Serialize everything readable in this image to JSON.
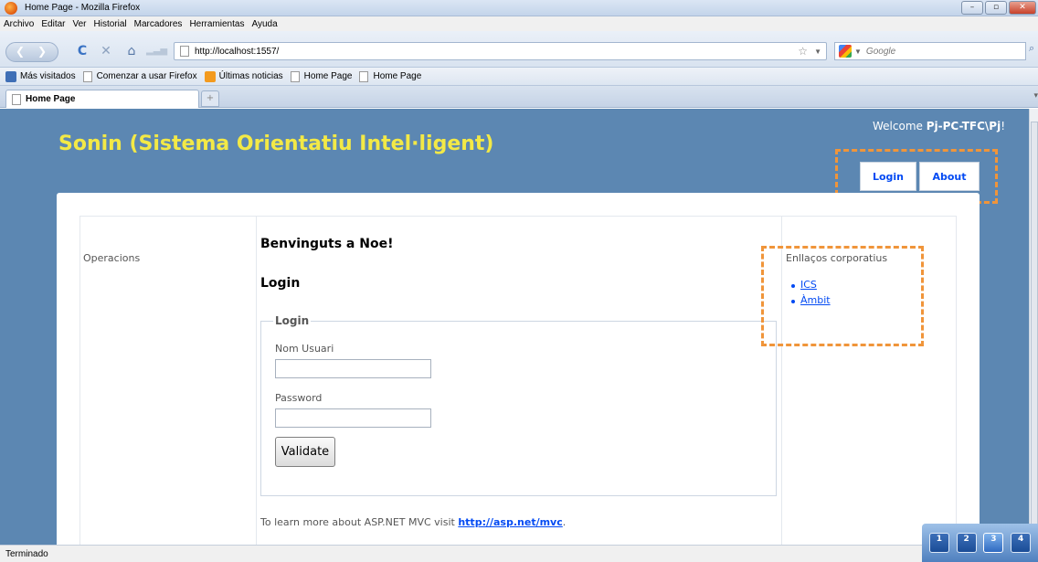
{
  "window": {
    "title": "Home Page - Mozilla Firefox",
    "controls": [
      "–",
      "▫",
      "✕"
    ]
  },
  "menubar": {
    "items": [
      "Archivo",
      "Editar",
      "Ver",
      "Historial",
      "Marcadores",
      "Herramientas",
      "Ayuda"
    ]
  },
  "navbar": {
    "back_glyph": "❮",
    "forward_glyph": "❯",
    "reload_glyph": "C",
    "stop_glyph": "✕",
    "home_glyph": "⌂",
    "url": "http://localhost:1557/",
    "search_placeholder": "Google",
    "search_glyph": "⌕"
  },
  "bookmarks": {
    "items": [
      "Más visitados",
      "Comenzar a usar Firefox",
      "Últimas noticias",
      "Home Page",
      "Home Page"
    ]
  },
  "tabs": {
    "active_label": "Home Page",
    "new_tab_glyph": "+"
  },
  "page": {
    "welcome_prefix": "Welcome",
    "welcome_user": "Pj-PC-TFC\\Pj",
    "welcome_suffix": "!",
    "site_title": "Sonin (Sistema Orientatiu Intel·ligent)",
    "menu": {
      "login": "Login",
      "about": "About"
    },
    "sidebar_left_label": "Operacions",
    "heading": "Benvinguts a Noe!",
    "login_heading": "Login",
    "fieldset_legend": "Login",
    "username_label": "Nom Usuari",
    "password_label": "Password",
    "validate_button": "Validate",
    "learn_text": "To learn more about ASP.NET MVC visit",
    "learn_link": "http://asp.net/mvc",
    "learn_end": ".",
    "links_title": "Enllaços corporatius",
    "links": [
      "ICS",
      "Àmbit"
    ]
  },
  "status": {
    "text": "Terminado"
  },
  "workspaces": [
    "1",
    "2",
    "3",
    "4"
  ],
  "colors": {
    "page_bg": "#5c87b2",
    "site_title": "#f3e946",
    "link": "#034af3",
    "highlight_box": "#f0953a"
  }
}
